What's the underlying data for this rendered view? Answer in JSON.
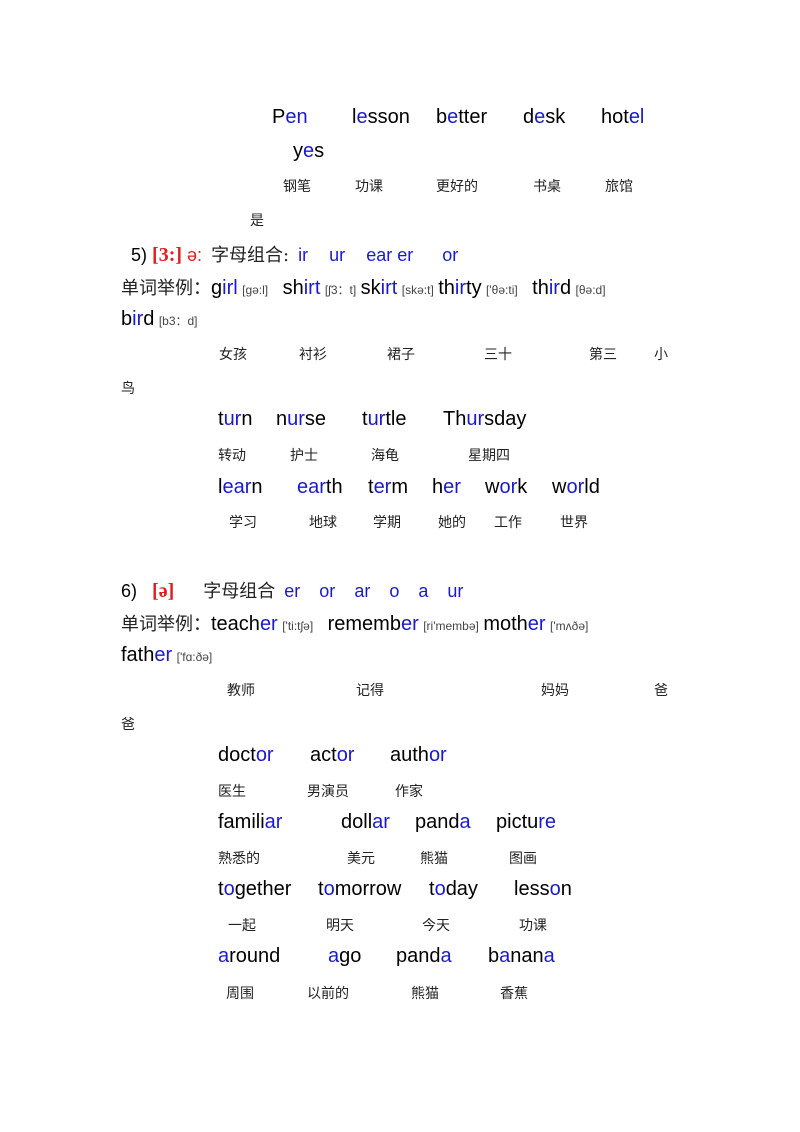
{
  "colors": {
    "highlight": "#1a1acc",
    "phoneme": "#e02020",
    "text": "#000000"
  },
  "e_section": {
    "words": [
      {
        "parts": [
          [
            "P",
            0
          ],
          [
            "en",
            1
          ]
        ]
      },
      {
        "parts": [
          [
            "l",
            0
          ],
          [
            "e",
            1
          ],
          [
            "sson",
            0
          ]
        ]
      },
      {
        "parts": [
          [
            "b",
            0
          ],
          [
            "e",
            1
          ],
          [
            "tter",
            0
          ]
        ]
      },
      {
        "parts": [
          [
            "d",
            0
          ],
          [
            "e",
            1
          ],
          [
            "sk",
            0
          ]
        ]
      },
      {
        "parts": [
          [
            "hot",
            0
          ],
          [
            "el",
            1
          ]
        ]
      },
      {
        "parts": [
          [
            "y",
            0
          ],
          [
            "e",
            1
          ],
          [
            "s",
            0
          ]
        ]
      }
    ],
    "meanings": [
      "钢笔",
      "功课",
      "更好的",
      "书桌",
      "旅馆",
      "是"
    ]
  },
  "section5": {
    "number": "5)",
    "symbol": "[3:]",
    "symbol2": "ə:",
    "combo_label": "字母组合:",
    "combos": [
      "ir",
      "ur",
      "ear er",
      "or"
    ],
    "examples_label": "单词举例：",
    "examples": [
      {
        "parts": [
          [
            "g",
            0
          ],
          [
            "irl",
            1
          ]
        ],
        "ipa": "[gə:l]"
      },
      {
        "parts": [
          [
            "sh",
            0
          ],
          [
            "irt",
            1
          ]
        ],
        "ipa": "[ʃ3：t]"
      },
      {
        "parts": [
          [
            "sk",
            0
          ],
          [
            "irt",
            1
          ]
        ],
        "ipa": "[skə:t]"
      },
      {
        "parts": [
          [
            "th",
            0
          ],
          [
            "ir",
            1
          ],
          [
            "ty",
            0
          ]
        ],
        "ipa": "['θə:ti]"
      },
      {
        "parts": [
          [
            "th",
            0
          ],
          [
            "ir",
            1
          ],
          [
            "d",
            0
          ]
        ],
        "ipa": "[θə:d]"
      },
      {
        "parts": [
          [
            "b",
            0
          ],
          [
            "ir",
            1
          ],
          [
            "d",
            0
          ]
        ],
        "ipa": "[b3：d]"
      }
    ],
    "example_meanings": [
      "女孩",
      "衬衫",
      "裙子",
      "三十",
      "第三",
      "小",
      "鸟"
    ],
    "row1": [
      {
        "parts": [
          [
            "t",
            0
          ],
          [
            "ur",
            1
          ],
          [
            "n",
            0
          ]
        ]
      },
      {
        "parts": [
          [
            "n",
            0
          ],
          [
            "ur",
            1
          ],
          [
            "se",
            0
          ]
        ]
      },
      {
        "parts": [
          [
            "t",
            0
          ],
          [
            "ur",
            1
          ],
          [
            "tle",
            0
          ]
        ]
      },
      {
        "parts": [
          [
            "Th",
            0
          ],
          [
            "ur",
            1
          ],
          [
            "sday",
            0
          ]
        ]
      }
    ],
    "row1_meanings": [
      "转动",
      "护士",
      "海龟",
      "星期四"
    ],
    "row2": [
      {
        "parts": [
          [
            "l",
            0
          ],
          [
            "ear",
            1
          ],
          [
            "n",
            0
          ]
        ]
      },
      {
        "parts": [
          [
            "ear",
            1
          ],
          [
            "th",
            0
          ]
        ]
      },
      {
        "parts": [
          [
            "t",
            0
          ],
          [
            "er",
            1
          ],
          [
            "m",
            0
          ]
        ]
      },
      {
        "parts": [
          [
            "h",
            0
          ],
          [
            "er",
            1
          ]
        ]
      },
      {
        "parts": [
          [
            "w",
            0
          ],
          [
            "or",
            1
          ],
          [
            "k",
            0
          ]
        ]
      },
      {
        "parts": [
          [
            "w",
            0
          ],
          [
            "or",
            1
          ],
          [
            "ld",
            0
          ]
        ]
      }
    ],
    "row2_meanings": [
      "学习",
      "地球",
      "学期",
      "她的",
      "工作",
      "世界"
    ]
  },
  "section6": {
    "number": "6)",
    "symbol": "[ə]",
    "combo_label": "字母组合",
    "combos": [
      "er",
      "or",
      "ar",
      "o",
      "a",
      "ur"
    ],
    "examples_label": "单词举例：",
    "examples": [
      {
        "parts": [
          [
            "teach",
            0
          ],
          [
            "er",
            1
          ]
        ],
        "ipa": "['ti:tʃə]"
      },
      {
        "parts": [
          [
            "rememb",
            0
          ],
          [
            "er",
            1
          ]
        ],
        "ipa": "[ri'membə]"
      },
      {
        "parts": [
          [
            "moth",
            0
          ],
          [
            "er",
            1
          ]
        ],
        "ipa": "['mʌðə]"
      },
      {
        "parts": [
          [
            "fath",
            0
          ],
          [
            "er",
            1
          ]
        ],
        "ipa": "['fɑ:ðə]"
      }
    ],
    "example_meanings": [
      "教师",
      "记得",
      "妈妈",
      "爸",
      "爸"
    ],
    "row1": [
      {
        "parts": [
          [
            "doct",
            0
          ],
          [
            "or",
            1
          ]
        ]
      },
      {
        "parts": [
          [
            "act",
            0
          ],
          [
            "or",
            1
          ]
        ]
      },
      {
        "parts": [
          [
            "auth",
            0
          ],
          [
            "or",
            1
          ]
        ]
      }
    ],
    "row1_meanings": [
      "医生",
      "男演员",
      "作家"
    ],
    "row2": [
      {
        "parts": [
          [
            "famili",
            0
          ],
          [
            "ar",
            1
          ]
        ]
      },
      {
        "parts": [
          [
            "doll",
            0
          ],
          [
            "ar",
            1
          ]
        ]
      },
      {
        "parts": [
          [
            "pand",
            0
          ],
          [
            "a",
            1
          ]
        ]
      },
      {
        "parts": [
          [
            "pictu",
            0
          ],
          [
            "re",
            1
          ]
        ]
      }
    ],
    "row2_meanings": [
      "熟悉的",
      "美元",
      "熊猫",
      "图画"
    ],
    "row3": [
      {
        "parts": [
          [
            "t",
            0
          ],
          [
            "o",
            1
          ],
          [
            "gether",
            0
          ]
        ]
      },
      {
        "parts": [
          [
            "t",
            0
          ],
          [
            "o",
            1
          ],
          [
            "morrow",
            0
          ]
        ]
      },
      {
        "parts": [
          [
            "t",
            0
          ],
          [
            "o",
            1
          ],
          [
            "day",
            0
          ]
        ]
      },
      {
        "parts": [
          [
            "less",
            0
          ],
          [
            "o",
            1
          ],
          [
            "n",
            0
          ]
        ]
      }
    ],
    "row3_meanings": [
      "一起",
      "明天",
      "今天",
      "功课"
    ],
    "row4": [
      {
        "parts": [
          [
            "a",
            1
          ],
          [
            "round",
            0
          ]
        ]
      },
      {
        "parts": [
          [
            "a",
            1
          ],
          [
            "go",
            0
          ]
        ]
      },
      {
        "parts": [
          [
            "pand",
            0
          ],
          [
            "a",
            1
          ]
        ]
      },
      {
        "parts": [
          [
            "b",
            0
          ],
          [
            "a",
            1
          ],
          [
            "nan",
            0
          ],
          [
            "a",
            1
          ]
        ]
      }
    ],
    "row4_meanings": [
      "周围",
      "以前的",
      "熊猫",
      "香蕉"
    ]
  }
}
